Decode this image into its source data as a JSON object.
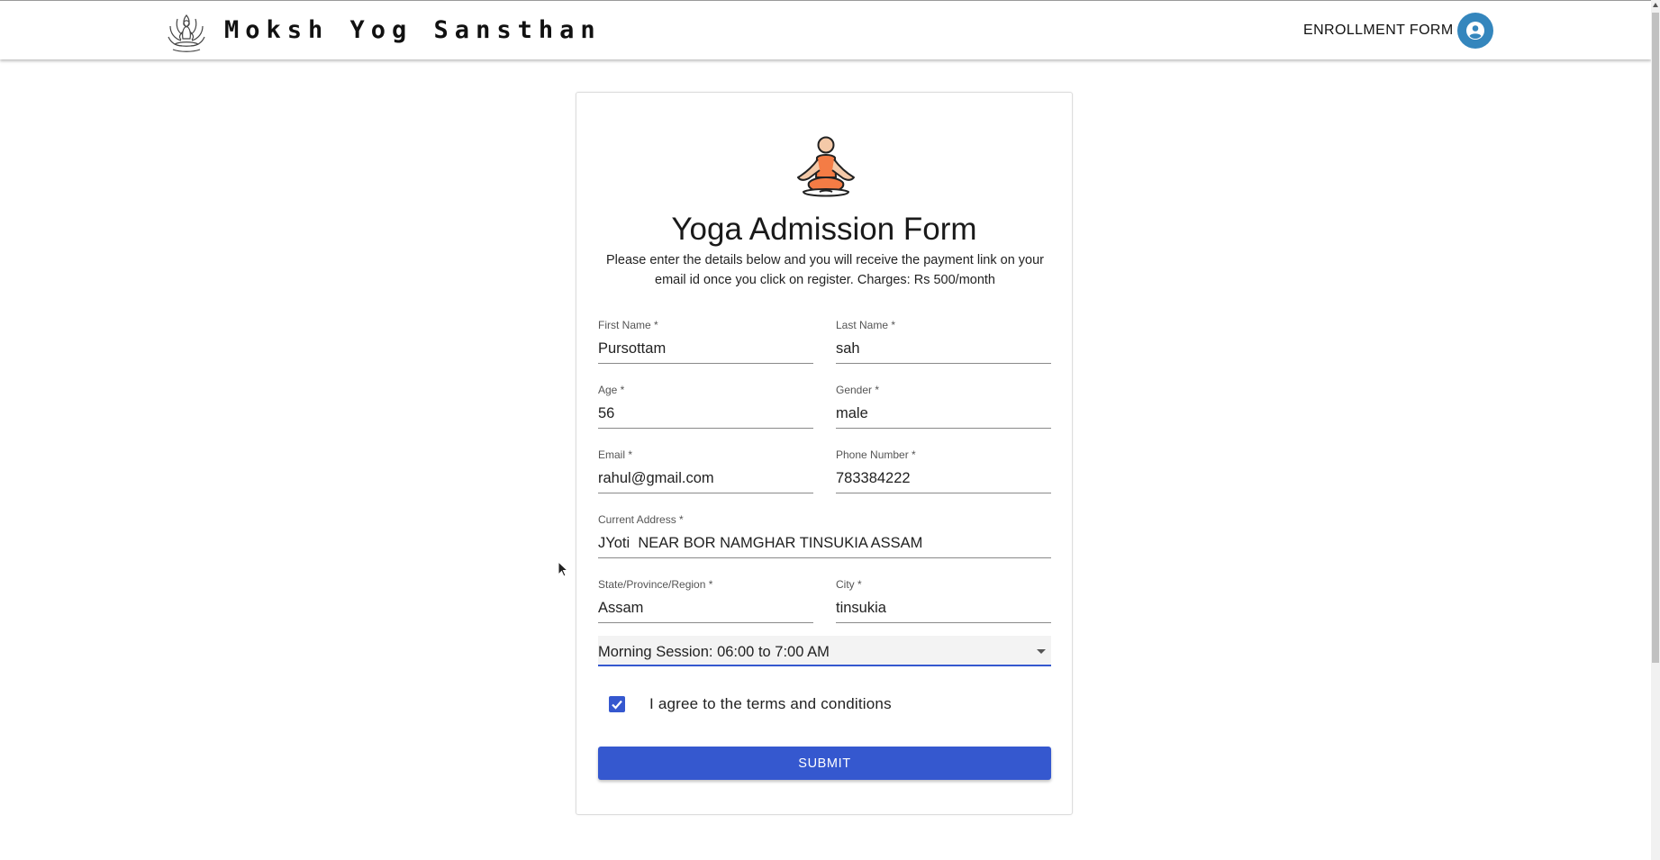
{
  "header": {
    "brand": "Moksh Yog Sansthan",
    "nav_link": "ENROLLMENT FORM",
    "logo_icon": "lotus-meditation-icon",
    "avatar_icon": "user-circle-icon",
    "avatar_color": "#3486bd"
  },
  "form": {
    "figure_icon": "yoga-pose-icon",
    "title": "Yoga Admission Form",
    "description": "Please enter the details below and you will receive the payment link on your email id once you click on register. Charges: Rs 500/month",
    "fields": {
      "first_name": {
        "label": "First Name *",
        "value": "Pursottam"
      },
      "last_name": {
        "label": "Last Name *",
        "value": "sah"
      },
      "age": {
        "label": "Age *",
        "value": "56"
      },
      "gender": {
        "label": "Gender *",
        "value": "male"
      },
      "email": {
        "label": "Email *",
        "value": "rahul@gmail.com"
      },
      "phone": {
        "label": "Phone Number *",
        "value": "783384222"
      },
      "address": {
        "label": "Current Address *",
        "value": "JYoti  NEAR BOR NAMGHAR TINSUKIA ASSAM"
      },
      "state": {
        "label": "State/Province/Region *",
        "value": "Assam"
      },
      "city": {
        "label": "City *",
        "value": "tinsukia"
      }
    },
    "session": {
      "selected": "Morning Session: 06:00 to 7:00 AM"
    },
    "agree": {
      "label": "I agree to the terms and conditions",
      "checked": true
    },
    "submit_label": "SUBMIT",
    "accent_color": "#3558cf"
  }
}
